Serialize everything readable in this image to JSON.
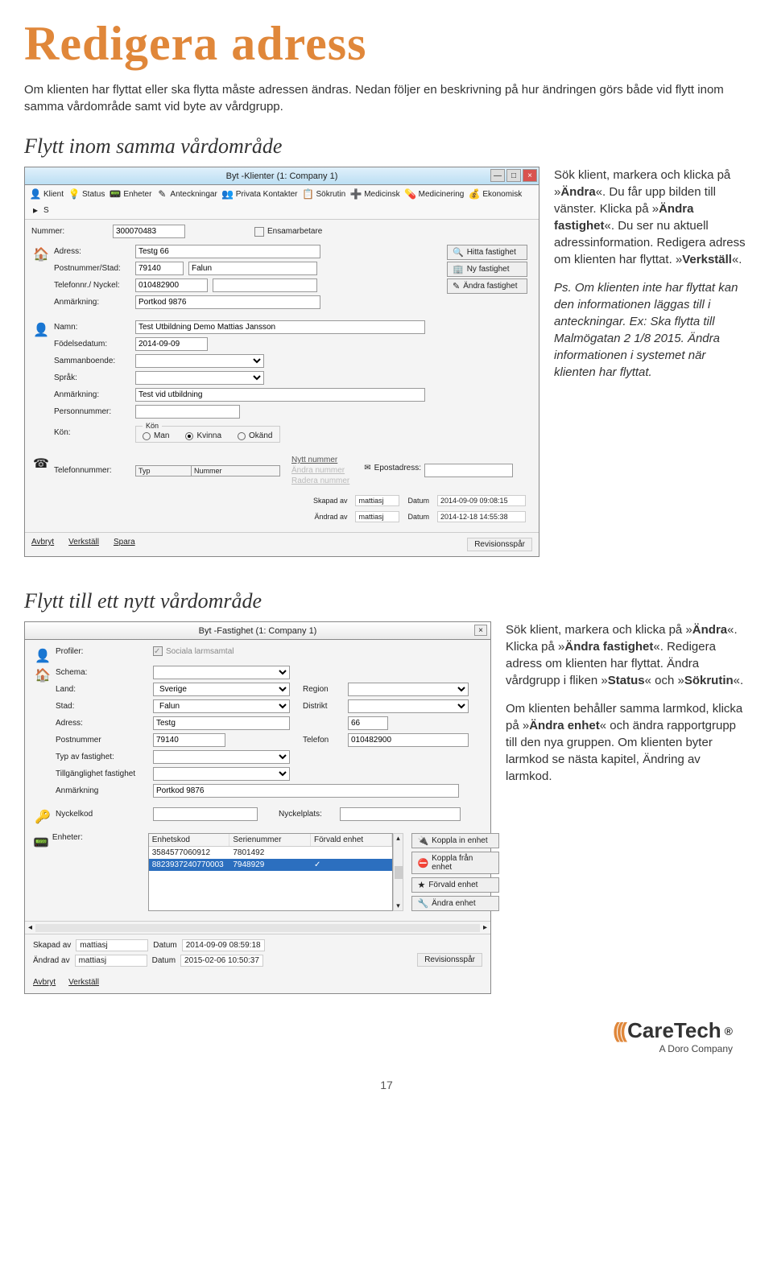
{
  "page": {
    "title": "Redigera adress",
    "intro": "Om klienten har flyttat eller ska flytta måste adressen ändras. Nedan följer en beskrivning på hur ändringen görs både vid flytt inom samma vårdområde samt vid byte av vårdgrupp.",
    "h2_1": "Flytt inom samma vårdområde",
    "h2_2": "Flytt till ett nytt vårdområde",
    "page_number": "17"
  },
  "side1": {
    "p1_a": "Sök klient, markera och klicka på »",
    "p1_b": "Ändra",
    "p1_c": "«. Du får upp bilden till vänster. Klicka på »",
    "p1_d": "Ändra fastighet",
    "p1_e": "«. Du ser nu aktuell adressinformation. Redigera adress om klienten har flyttat. »",
    "p1_f": "Verkställ",
    "p1_g": "«.",
    "p2": "Ps. Om klienten inte har flyttat kan den informationen läggas till i anteckningar. Ex: Ska flytta till Malmögatan 2 1/8 2015. Ändra informationen i systemet när klienten har flyttat."
  },
  "side2": {
    "p1_a": "Sök klient, markera och klicka på »",
    "p1_b": "Ändra",
    "p1_c": "«. Klicka på »",
    "p1_d": "Ändra fastighet",
    "p1_e": "«. Redigera adress om klienten har flyttat. Ändra vårdgrupp i fliken »",
    "p1_f": "Status",
    "p1_g": "« och »",
    "p1_h": "Sökrutin",
    "p1_i": "«.",
    "p2_a": "Om klienten behåller samma larmkod, klicka på »",
    "p2_b": "Ändra enhet",
    "p2_c": "« och ändra rapportgrupp till den nya gruppen. Om klienten byter larmkod se nästa kapitel, Ändring av larmkod."
  },
  "win1": {
    "title": "Byt -Klienter (1: Company 1)",
    "toolbar": [
      "Klient",
      "Status",
      "Enheter",
      "Anteckningar",
      "Privata Kontakter",
      "Sökrutin",
      "Medicinsk",
      "Medicinering",
      "Ekonomisk",
      "S"
    ],
    "nummer_lbl": "Nummer:",
    "nummer": "300070483",
    "ensam_lbl": "Ensamarbetare",
    "adress_lbl": "Adress:",
    "adress": "Testg 66",
    "post_lbl": "Postnummer/Stad:",
    "post": "79140",
    "stad": "Falun",
    "tel_lbl": "Telefonnr./ Nyckel:",
    "tel": "010482900",
    "anm_lbl": "Anmärkning:",
    "anm": "Portkod 9876",
    "rbtn_hitta": "Hitta fastighet",
    "rbtn_ny": "Ny fastighet",
    "rbtn_andra": "Ändra fastighet",
    "namn_lbl": "Namn:",
    "namn": "Test Utbildning Demo Mattias Jansson",
    "fodd_lbl": "Födelsedatum:",
    "fodd": "2014-09-09",
    "sammbo_lbl": "Sammanboende:",
    "sprak_lbl": "Språk:",
    "anm2_lbl": "Anmärkning:",
    "anm2": "Test vid utbildning",
    "pnr_lbl": "Personnummer:",
    "kon_lbl": "Kön:",
    "kon_hdr": "Kön",
    "kon_man": "Man",
    "kon_kvinna": "Kvinna",
    "kon_okand": "Okänd",
    "telnr_lbl": "Telefonnummer:",
    "typ_lbl": "Typ",
    "num_lbl": "Nummer",
    "sub_nytt": "Nytt nummer",
    "sub_andra": "Ändra nummer",
    "sub_radera": "Radera nummer",
    "epost_lbl": "Epostadress:",
    "skapad_lbl": "Skapad av",
    "skapad_v": "mattiasj",
    "datum_lbl": "Datum",
    "skapad_d": "2014-09-09 09:08:15",
    "andrad_lbl": "Ändrad av",
    "andrad_v": "mattiasj",
    "andrad_d": "2014-12-18 14:55:38",
    "avbryt": "Avbryt",
    "verkstall": "Verkställ",
    "spara": "Spara",
    "rev": "Revisionsspår"
  },
  "win2": {
    "title": "Byt -Fastighet (1: Company 1)",
    "profiler_lbl": "Profiler:",
    "profiler_chk": "Sociala larmsamtal",
    "schema_lbl": "Schema:",
    "land_lbl": "Land:",
    "land": "Sverige",
    "region_lbl": "Region",
    "stad_lbl": "Stad:",
    "stad": "Falun",
    "distrikt_lbl": "Distrikt",
    "adress_lbl": "Adress:",
    "adress": "Testg",
    "adress_nr": "66",
    "post_lbl": "Postnummer",
    "post": "79140",
    "tel_lbl": "Telefon",
    "tel": "010482900",
    "typf_lbl": "Typ av fastighet:",
    "tillg_lbl": "Tillgänglighet fastighet",
    "anm_lbl": "Anmärkning",
    "anm": "Portkod 9876",
    "nyckel_lbl": "Nyckelkod",
    "nyckelplats_lbl": "Nyckelplats:",
    "enh_lbl": "Enheter:",
    "th1": "Enhetskod",
    "th2": "Serienummer",
    "th3": "Förvald enhet",
    "r1c1": "3584577060912",
    "r1c2": "7801492",
    "r1c3": "",
    "r2c1": "8823937240770003",
    "r2c2": "7948929",
    "r2c3": "✓",
    "eb1": "Koppla in enhet",
    "eb2": "Koppla från enhet",
    "eb3": "Förvald enhet",
    "eb4": "Ändra enhet",
    "skapad_lbl": "Skapad av",
    "skapad_v": "mattiasj",
    "datum_lbl": "Datum",
    "skapad_d": "2014-09-09 08:59:18",
    "andrad_lbl": "Ändrad av",
    "andrad_v": "mattiasj",
    "andrad_d": "2015-02-06 10:50:37",
    "rev": "Revisionsspår",
    "avbryt": "Avbryt",
    "verkstall": "Verkställ"
  },
  "brand": {
    "name": "CareTech",
    "sub": "A Doro Company",
    "reg": "®"
  }
}
